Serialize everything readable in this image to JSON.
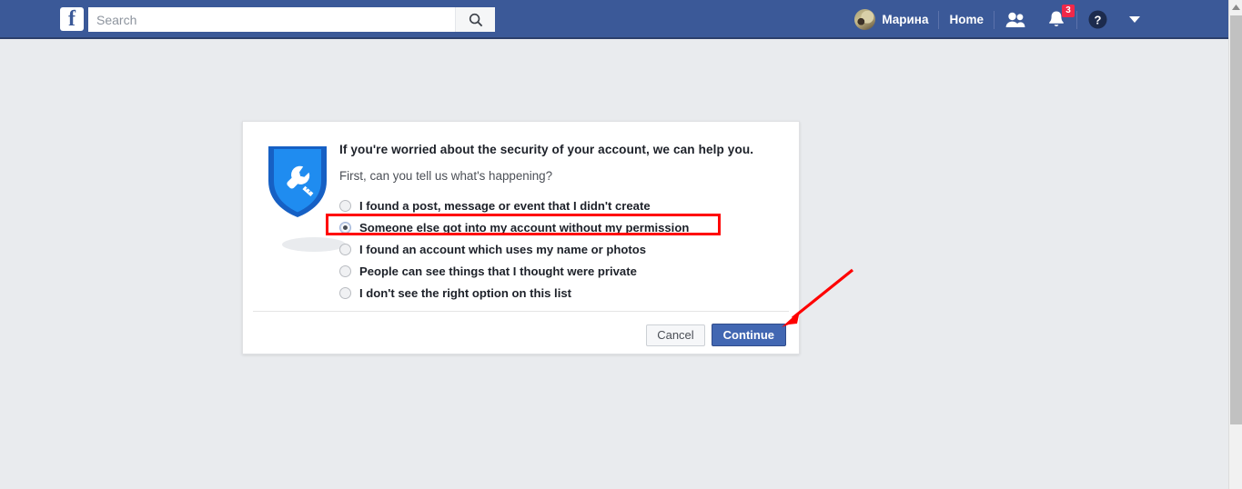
{
  "header": {
    "logo_label": "f",
    "search": {
      "value": "",
      "placeholder": "Search",
      "icon": "search-icon"
    },
    "profile_name": "Марина",
    "home_label": "Home",
    "friends_icon": "friend-requests-icon",
    "notifications_icon": "bell-icon",
    "notifications_count": "3",
    "help_icon": "help-question-icon",
    "menu_icon": "chevron-down-icon",
    "bar_color": "#3b5998",
    "badge_color": "#f02849"
  },
  "dialog": {
    "icon": "shield-wrench-icon",
    "headline": "If you're worried about the security of your account, we can help you.",
    "subline": "First, can you tell us what's happening?",
    "options": [
      {
        "label": "I found a post, message or event that I didn't create",
        "selected": false
      },
      {
        "label": "Someone else got into my account without my permission",
        "selected": true
      },
      {
        "label": "I found an account which uses my name or photos",
        "selected": false
      },
      {
        "label": "People can see things that I thought were private",
        "selected": false
      },
      {
        "label": "I don't see the right option on this list",
        "selected": false
      }
    ],
    "cancel_label": "Cancel",
    "continue_label": "Continue",
    "continue_color": "#4267b2"
  },
  "annotations": {
    "highlight_color": "#ff0000",
    "highlight_target": "Someone else got into my account without my permission",
    "arrow_color": "#ff0000",
    "arrow_target": "Continue"
  },
  "page": {
    "background": "#e9ebee"
  }
}
